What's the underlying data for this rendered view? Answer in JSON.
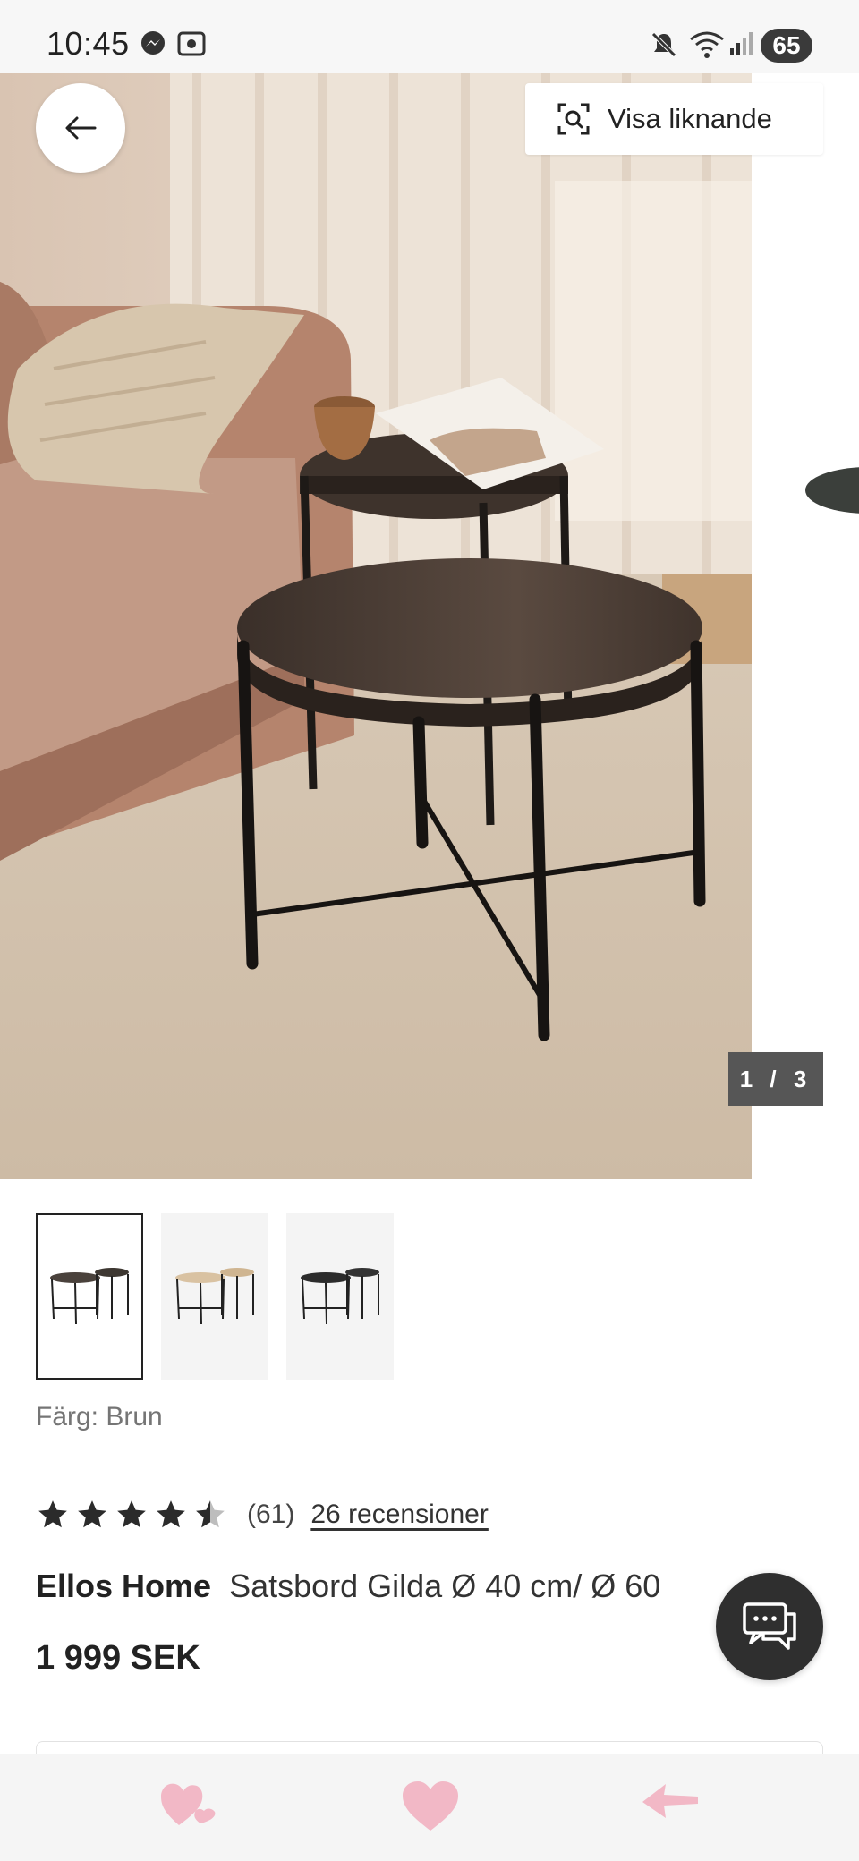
{
  "status_bar": {
    "time": "10:45",
    "battery": "65",
    "icons": [
      "messenger-icon",
      "screen-record-icon",
      "mute-icon",
      "wifi-icon",
      "signal-icon"
    ]
  },
  "gallery": {
    "similar_label": "Visa liknande",
    "counter": "1 / 3",
    "thumbnails": [
      "brun",
      "natur",
      "svart"
    ]
  },
  "product": {
    "color_label": "Färg: Brun",
    "rating_value": 4.5,
    "rating_count": "(61)",
    "reviews_label": "26 recensioner",
    "brand": "Ellos Home",
    "name": "Satsbord Gilda Ø 40 cm/ Ø 60",
    "price": "1 999 SEK"
  },
  "bottom_bar": {
    "icons": [
      "hearts-icon",
      "heart-icon",
      "arrow-left-icon"
    ]
  },
  "colors": {
    "accent_pink": "#f2b8c6",
    "dark": "#2f2f2f",
    "counter_bg": "#565656"
  }
}
